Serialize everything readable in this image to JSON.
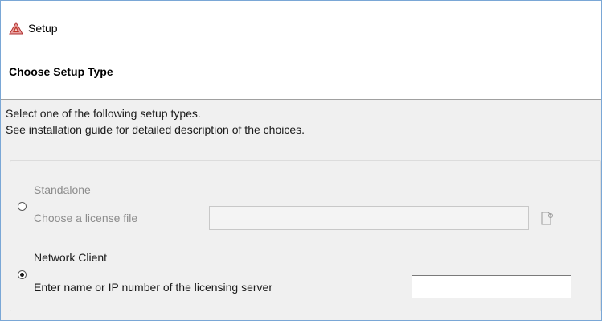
{
  "window": {
    "title": "Setup",
    "page_title": "Choose Setup Type"
  },
  "intro": {
    "line1": "Select one of the following setup types.",
    "line2": "See installation guide for detailed description of the choices."
  },
  "options": {
    "standalone": {
      "label": "Standalone",
      "field_label": "Choose a license file",
      "field_value": "",
      "selected": false
    },
    "network_client": {
      "label": "Network Client",
      "field_label": "Enter name or IP number of the licensing server",
      "field_value": "",
      "selected": true
    }
  },
  "icons": {
    "app": "setup-logo-icon",
    "browse": "browse-file-icon"
  },
  "colors": {
    "disabled_text": "#8c8c8c",
    "app_icon": "#c0392b"
  }
}
